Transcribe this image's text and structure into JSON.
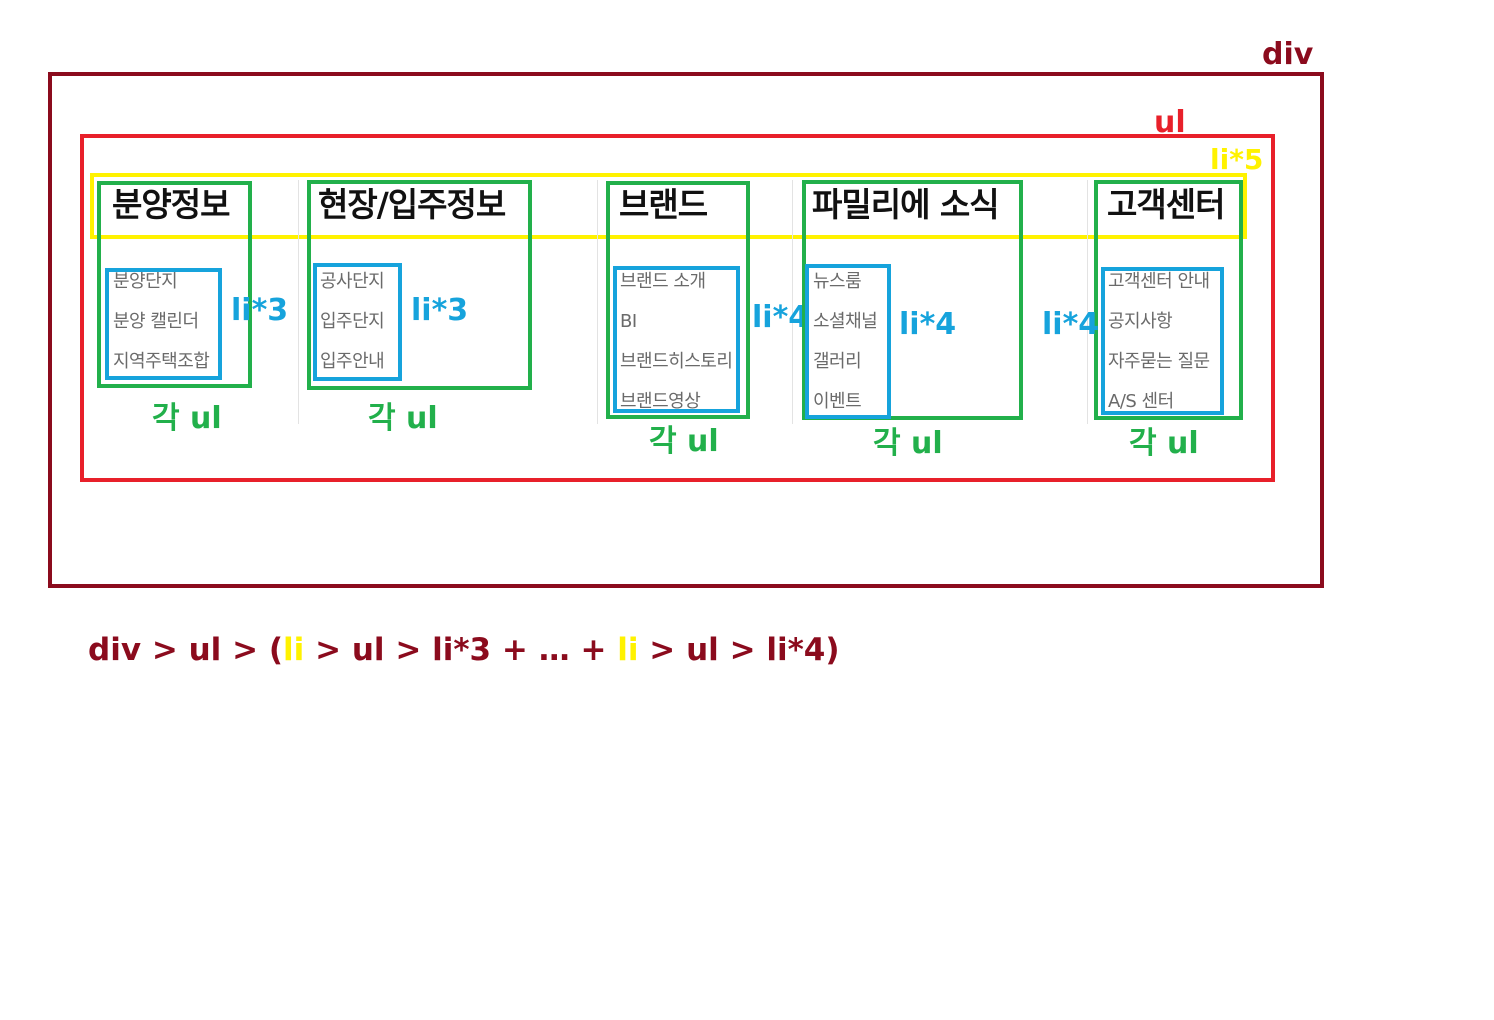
{
  "labels": {
    "div": "div",
    "ul": "ul",
    "li5": "li*5",
    "each_ul": "각 ul",
    "li3": "li*3",
    "li4": "li*4"
  },
  "menus": [
    {
      "title": "분양정보",
      "items": [
        "분양단지",
        "분양 캘린더",
        "지역주택조합"
      ]
    },
    {
      "title": "현장/입주정보",
      "items": [
        "공사단지",
        "입주단지",
        "입주안내"
      ]
    },
    {
      "title": "브랜드",
      "items": [
        "브랜드 소개",
        "BI",
        "브랜드히스토리",
        "브랜드영상"
      ]
    },
    {
      "title": "파밀리에 소식",
      "items": [
        "뉴스룸",
        "소셜채널",
        "갤러리",
        "이벤트"
      ]
    },
    {
      "title": "고객센터",
      "items": [
        "고객센터 안내",
        "공지사항",
        "자주묻는 질문",
        "A/S 센터"
      ]
    }
  ],
  "formula": {
    "p1": "div > ul > (",
    "li_a": "li",
    "p2": " > ul > li*3 + … + ",
    "li_b": "li",
    "p3": " > ul > li*4)"
  },
  "colors": {
    "div": "#8b0b1d",
    "ul": "#e8202a",
    "li": "#fff200",
    "each_ul": "#22b04b",
    "sub_li": "#16a3dc"
  }
}
